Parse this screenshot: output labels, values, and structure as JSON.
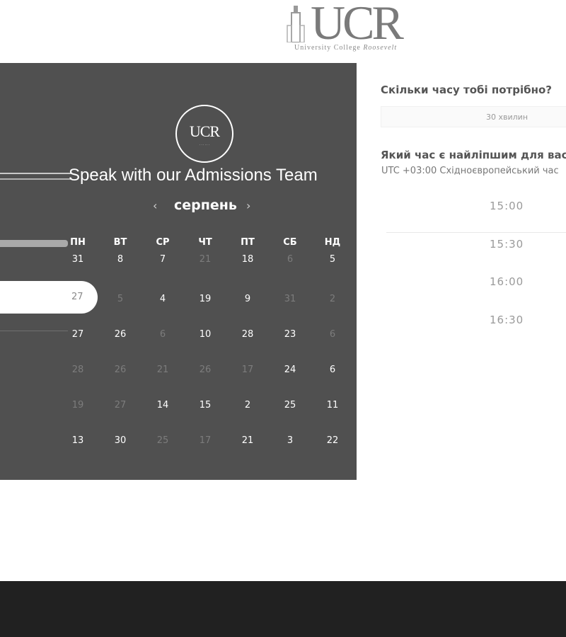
{
  "header": {
    "logo_text": "UCR",
    "logo_subtitle": "University College",
    "logo_subtitle_script": "Roosevelt"
  },
  "calendar": {
    "emblem_text": "UCR",
    "title": "Speak with our Admissions Team",
    "month": "серпень",
    "prev_glyph": "‹",
    "next_glyph": "›",
    "weekdays": [
      "ПН",
      "ВТ",
      "СР",
      "ЧТ",
      "ПТ",
      "СБ",
      "НД"
    ],
    "selected_day": "27",
    "weeks": [
      [
        {
          "d": "31",
          "dim": false
        },
        {
          "d": "8",
          "dim": false
        },
        {
          "d": "7",
          "dim": false
        },
        {
          "d": "21",
          "dim": true
        },
        {
          "d": "18",
          "dim": false
        },
        {
          "d": "6",
          "dim": true
        },
        {
          "d": "5",
          "dim": false
        }
      ],
      [
        {
          "d": "27",
          "dim": false,
          "selected": true
        },
        {
          "d": "5",
          "dim": true
        },
        {
          "d": "4",
          "dim": false
        },
        {
          "d": "19",
          "dim": false
        },
        {
          "d": "9",
          "dim": false
        },
        {
          "d": "31",
          "dim": true
        },
        {
          "d": "2",
          "dim": true
        }
      ],
      [
        {
          "d": "27",
          "dim": false
        },
        {
          "d": "26",
          "dim": false
        },
        {
          "d": "6",
          "dim": true
        },
        {
          "d": "10",
          "dim": false
        },
        {
          "d": "28",
          "dim": false
        },
        {
          "d": "23",
          "dim": false
        },
        {
          "d": "6",
          "dim": true
        }
      ],
      [
        {
          "d": "28",
          "dim": true
        },
        {
          "d": "26",
          "dim": true
        },
        {
          "d": "21",
          "dim": true
        },
        {
          "d": "26",
          "dim": true
        },
        {
          "d": "17",
          "dim": true
        },
        {
          "d": "24",
          "dim": false
        },
        {
          "d": "6",
          "dim": false
        }
      ],
      [
        {
          "d": "19",
          "dim": true
        },
        {
          "d": "27",
          "dim": true
        },
        {
          "d": "14",
          "dim": false
        },
        {
          "d": "15",
          "dim": false
        },
        {
          "d": "2",
          "dim": false
        },
        {
          "d": "25",
          "dim": false
        },
        {
          "d": "11",
          "dim": false
        }
      ],
      [
        {
          "d": "13",
          "dim": false
        },
        {
          "d": "30",
          "dim": false
        },
        {
          "d": "25",
          "dim": true
        },
        {
          "d": "17",
          "dim": true
        },
        {
          "d": "21",
          "dim": false
        },
        {
          "d": "3",
          "dim": false
        },
        {
          "d": "22",
          "dim": false
        }
      ]
    ]
  },
  "booking": {
    "duration_question": "Скільки часу тобі потрібно?",
    "duration_value": "30 хвилин",
    "time_question": "Який час є найліпшим для вас?",
    "timezone": "UTC +03:00 Східноєвропейський час",
    "slots": [
      "15:00",
      "15:30",
      "16:00",
      "16:30"
    ]
  },
  "colors": {
    "panel_bg": "#505050",
    "footer_bg": "#212121",
    "dim_day": "#7c7c7c"
  }
}
